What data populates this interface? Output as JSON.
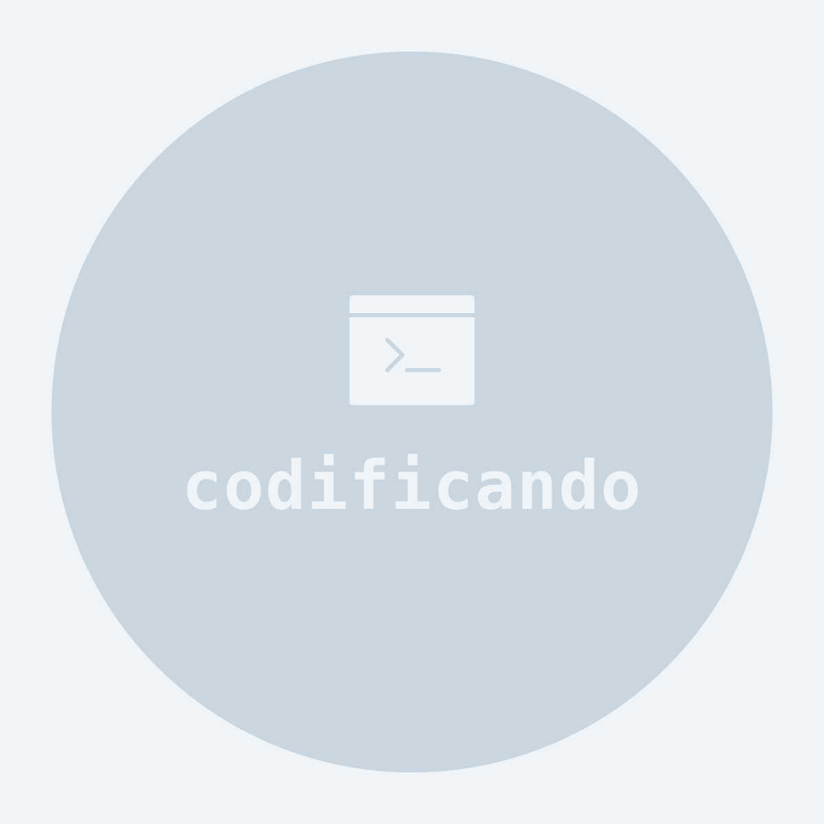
{
  "logo": {
    "wordmark": "codificando",
    "icon": "terminal-window-icon"
  },
  "colors": {
    "background": "#eff4f8",
    "circle": "#c9d6df",
    "foreground": "#eff4f8"
  }
}
